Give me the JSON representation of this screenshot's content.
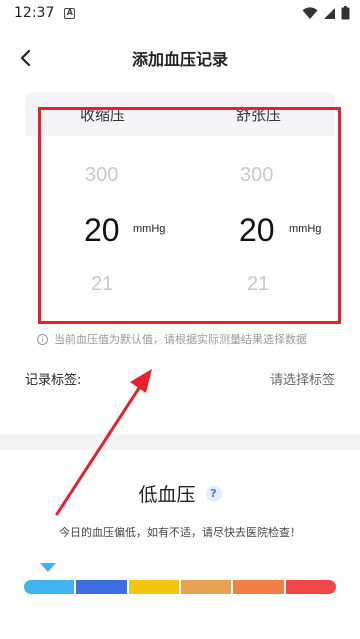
{
  "status_bar": {
    "time": "12:37",
    "notification_icon": "a-icon",
    "icons": [
      "wifi-icon",
      "signal-icon",
      "battery-icon"
    ]
  },
  "header": {
    "title": "添加血压记录",
    "back_icon": "back-arrow-icon"
  },
  "picker": {
    "systolic": {
      "label": "收缩压",
      "above": "300",
      "selected": "20",
      "below": "21",
      "unit": "mmHg"
    },
    "diastolic": {
      "label": "舒张压",
      "above": "300",
      "selected": "20",
      "below": "21",
      "unit": "mmHg"
    }
  },
  "info": {
    "text": "当前血压值为默认值，请根据实际测量结果选择数据"
  },
  "tags": {
    "label": "记录标签:",
    "placeholder": "请选择标签"
  },
  "result": {
    "label": "低血压",
    "help_symbol": "?",
    "description": "今日的血压偏低，如有不适，请尽快去医院检查！",
    "scale_colors": [
      "#41b3ee",
      "#3d6fe0",
      "#f6c40f",
      "#e8a052",
      "#f37f45",
      "#ef4747"
    ],
    "indicator_level": 0
  },
  "annotations": {
    "highlight_color": "#e8202c",
    "arrow_color": "#e8202c"
  }
}
